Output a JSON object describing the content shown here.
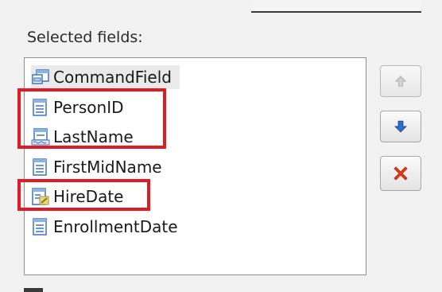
{
  "fields": {
    "label": "Selected fields:",
    "items": [
      {
        "label": "CommandField",
        "icon": "command-field-icon"
      },
      {
        "label": "PersonID",
        "icon": "bound-field-icon"
      },
      {
        "label": "LastName",
        "icon": "hyperlink-field-icon"
      },
      {
        "label": "FirstMidName",
        "icon": "bound-field-icon"
      },
      {
        "label": "HireDate",
        "icon": "template-field-icon"
      },
      {
        "label": "EnrollmentDate",
        "icon": "bound-field-icon"
      }
    ],
    "selected_item": "CommandField"
  },
  "buttons": {
    "move_up": "arrow-up-icon",
    "move_down": "arrow-down-icon",
    "delete": "delete-x-icon"
  },
  "colors": {
    "highlight": "#e01b24",
    "icon_blue": "#3b73c4",
    "down_arrow": "#2f6fd0",
    "delete_red": "#e53a1e"
  }
}
